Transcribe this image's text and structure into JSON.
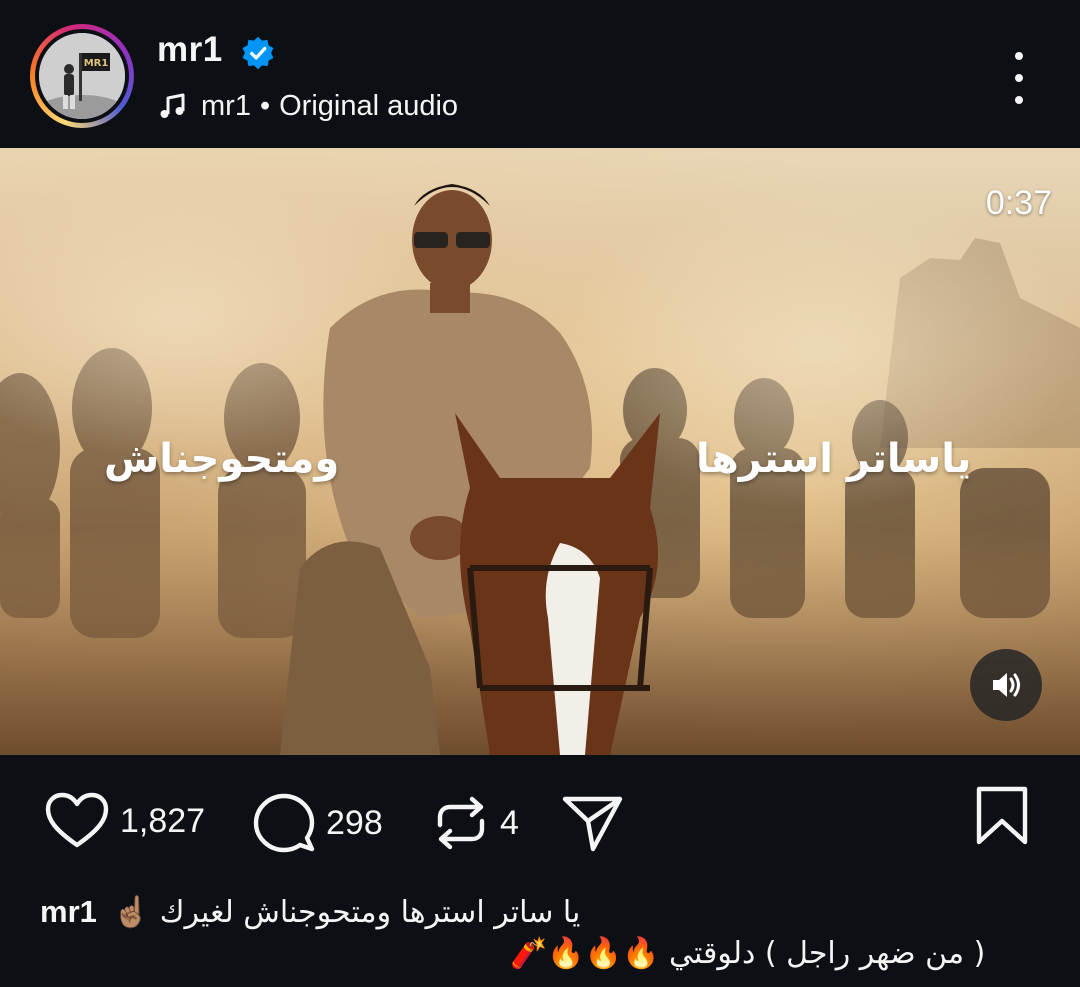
{
  "header": {
    "username": "mr1",
    "verified": true,
    "audio_artist": "mr1",
    "audio_separator": "•",
    "audio_title": "Original audio",
    "avatar_text": "MR1"
  },
  "video": {
    "duration": "0:37",
    "overlay_text_left": "ومتحوجناش",
    "overlay_text_right": "ياساتر استرها"
  },
  "actions": {
    "likes": "1,827",
    "comments": "298",
    "reposts": "4"
  },
  "caption": {
    "username": "mr1",
    "line1": "يا ساتر استرها ومتحوجناش لغيرك ☝🏽",
    "line2": "( من ضهر راجل ) دلوقتي 🔥🔥🔥🧨"
  },
  "colors": {
    "background": "#0c1014",
    "text": "#f5f5f5",
    "verified_blue": "#0095f6"
  }
}
